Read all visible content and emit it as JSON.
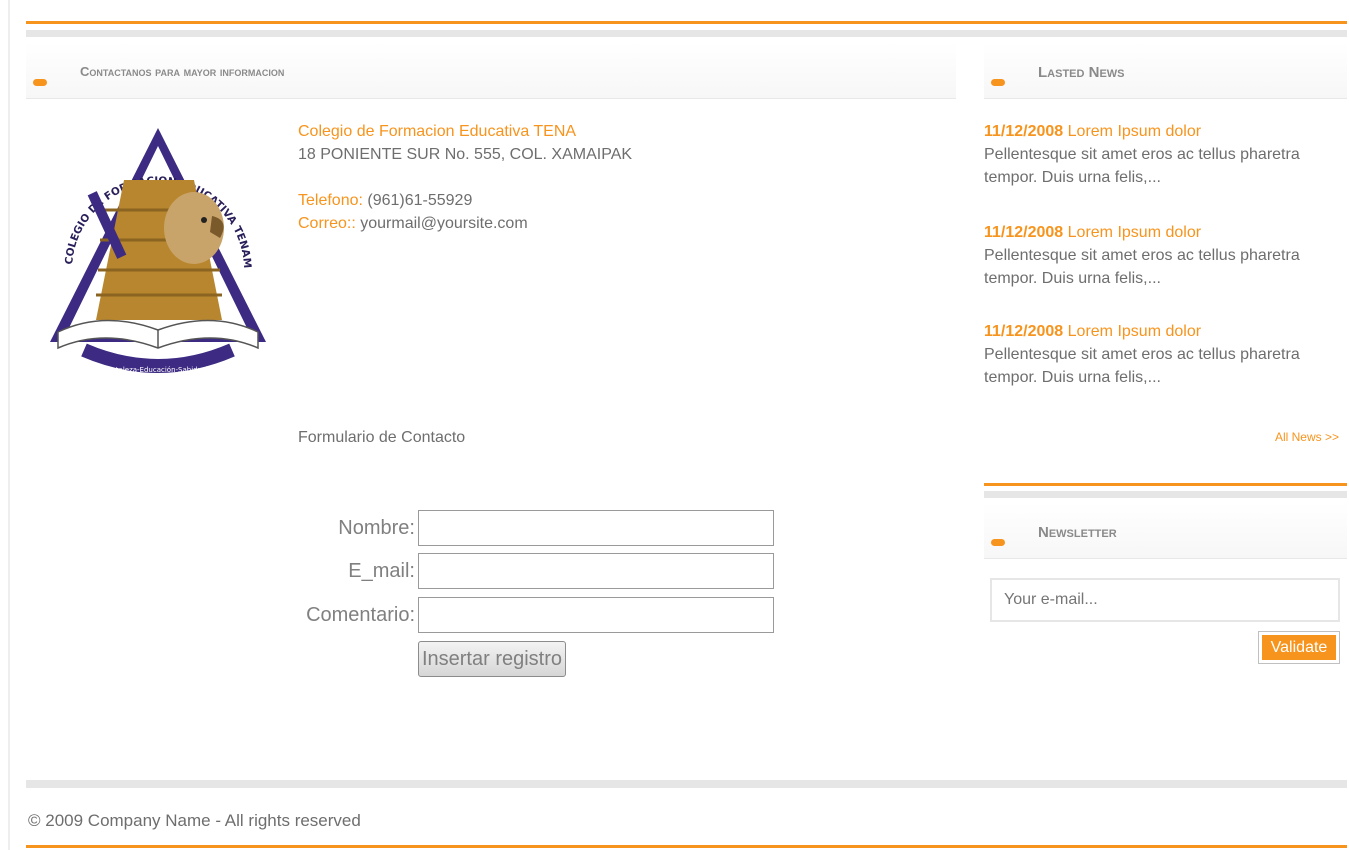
{
  "contact": {
    "heading": "Contactanos para mayor informacion",
    "school_name": "Colegio de Formacion Educativa TENA",
    "address": "18 PONIENTE SUR No. 555, COL. XAMAIPAK",
    "phone_label": "Telefono:",
    "phone_value": " (961)61-55929",
    "email_label": "Correo::",
    "email_value": " yourmail@yoursite.com",
    "logo": {
      "ring_text": "COLEGIO DE FORMACION EDUCATIVA TENAM, S.C.",
      "motto": "Fortaleza-Educación-Sabiduría"
    },
    "form_title": "Formulario de Contacto",
    "form": {
      "name_label": "Nombre:",
      "email_label": "E_mail:",
      "comment_label": "Comentario:",
      "submit_label": "Insertar registro",
      "name_value": "",
      "email_value": "",
      "comment_value": ""
    }
  },
  "news": {
    "heading": "Lasted News",
    "items": [
      {
        "date": "11/12/2008",
        "title": " Lorem Ipsum dolor",
        "text": "Pellentesque sit amet eros ac tellus pharetra tempor. Duis urna felis,..."
      },
      {
        "date": "11/12/2008",
        "title": " Lorem Ipsum dolor",
        "text": "Pellentesque sit amet eros ac tellus pharetra tempor. Duis urna felis,..."
      },
      {
        "date": "11/12/2008",
        "title": " Lorem Ipsum dolor",
        "text": "Pellentesque sit amet eros ac tellus pharetra tempor. Duis urna felis,..."
      }
    ],
    "all_link": "All News >>"
  },
  "newsletter": {
    "heading": "Newsletter",
    "placeholder": "Your e-mail...",
    "button": "Validate"
  },
  "footer": {
    "copyright": "© 2009 Company Name - All rights reserved"
  },
  "colors": {
    "accent": "#f7941d",
    "text": "#6e6e6e",
    "logo_purple": "#3d2a82",
    "logo_gold": "#b8862e"
  }
}
